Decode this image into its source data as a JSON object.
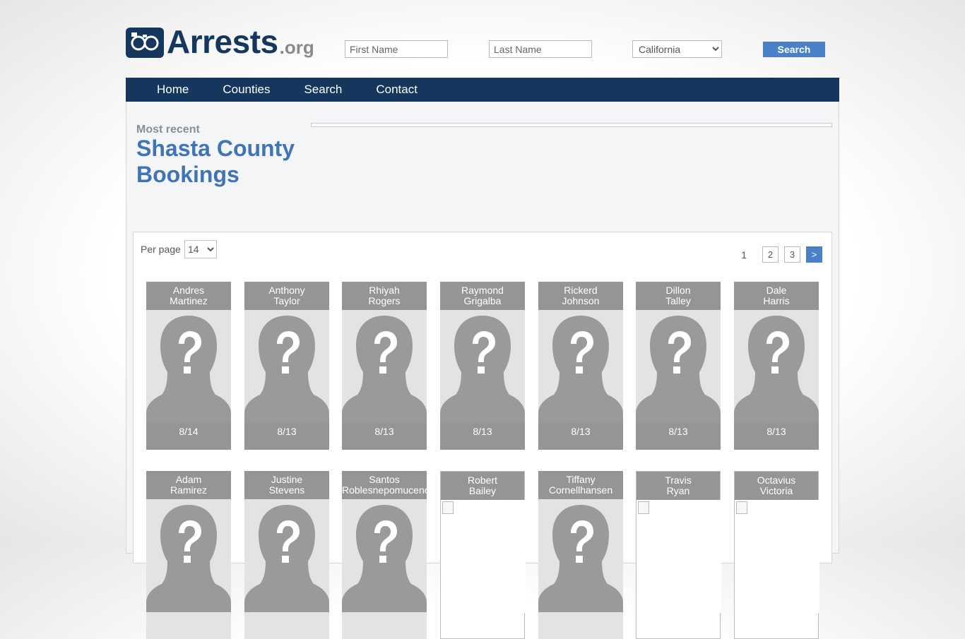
{
  "brand": {
    "name": "Arrests",
    "tld": ".org"
  },
  "search": {
    "first_placeholder": "First Name",
    "last_placeholder": "Last Name",
    "state_value": "California",
    "button_label": "Search"
  },
  "nav": {
    "items": [
      "Home",
      "Counties",
      "Search",
      "Contact"
    ]
  },
  "heading": {
    "kicker": "Most recent",
    "title": "Shasta County Bookings"
  },
  "listing": {
    "per_page_label": "Per page",
    "per_page_value": "14",
    "pagination": {
      "current": "1",
      "pages": [
        "2",
        "3"
      ],
      "next": ">"
    },
    "row1": [
      {
        "first": "Andres",
        "last": "Martinez",
        "date": "8/14"
      },
      {
        "first": "Anthony",
        "last": "Taylor",
        "date": "8/13"
      },
      {
        "first": "Rhiyah",
        "last": "Rogers",
        "date": "8/13"
      },
      {
        "first": "Raymond",
        "last": "Grigalba",
        "date": "8/13"
      },
      {
        "first": "Rickerd",
        "last": "Johnson",
        "date": "8/13"
      },
      {
        "first": "Dillon",
        "last": "Talley",
        "date": "8/13"
      },
      {
        "first": "Dale",
        "last": "Harris",
        "date": "8/13"
      }
    ],
    "row2": [
      {
        "first": "Adam",
        "last": "Ramirez"
      },
      {
        "first": "Justine",
        "last": "Stevens"
      },
      {
        "first": "Santos",
        "last": "Roblesnepomuceno"
      },
      {
        "first": "Robert",
        "last": "Bailey"
      },
      {
        "first": "Tiffany",
        "last": "Cornellhansen"
      },
      {
        "first": "Travis",
        "last": "Ryan"
      },
      {
        "first": "Octavius",
        "last": "Victoria"
      }
    ]
  },
  "colors": {
    "brand_navy": "#15375e",
    "accent_blue": "#4a80c8",
    "card_gray": "#969494"
  }
}
